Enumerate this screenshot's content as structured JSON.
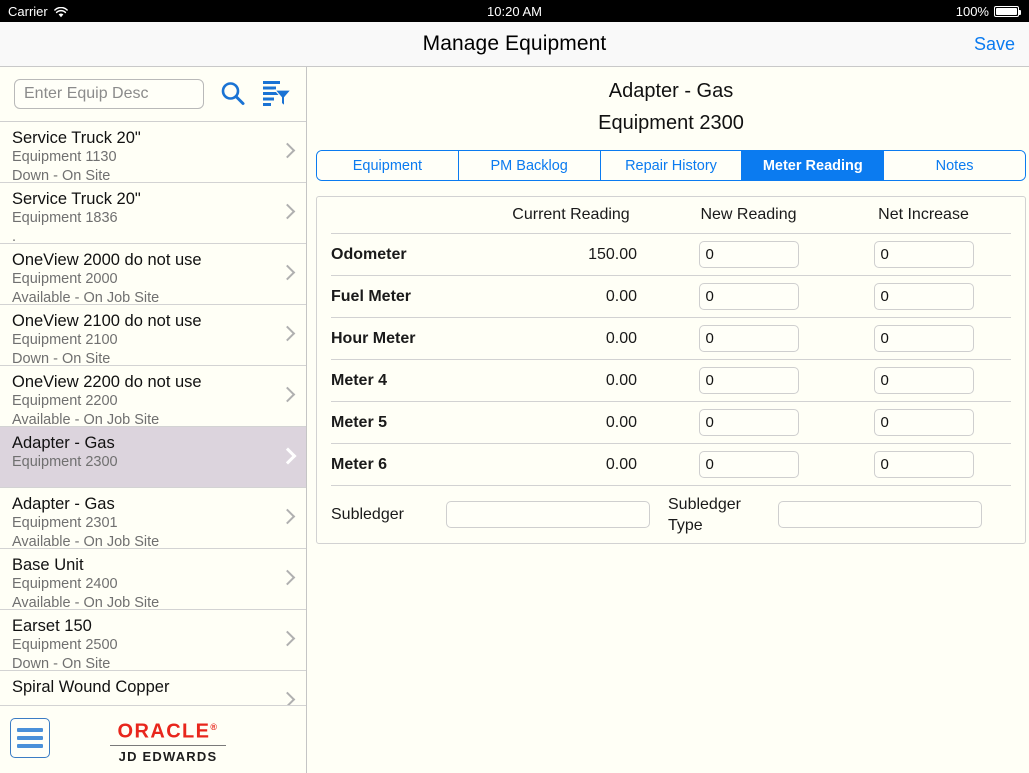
{
  "statusbar": {
    "carrier": "Carrier",
    "wifi_icon": "wifi-icon",
    "time": "10:20 AM",
    "battery_pct": "100%",
    "battery_icon": "battery-icon"
  },
  "navbar": {
    "title": "Manage Equipment",
    "save_label": "Save"
  },
  "sidebar": {
    "search": {
      "placeholder": "Enter Equip Desc",
      "value": "",
      "search_icon": "search-icon",
      "filter_icon": "filter-icon"
    },
    "items": [
      {
        "title": "Service Truck 20\"",
        "equipment": "Equipment 1130",
        "status": "Down - On Site",
        "selected": false
      },
      {
        "title": "Service Truck 20\"",
        "equipment": "Equipment 1836",
        "status": ".",
        "selected": false
      },
      {
        "title": "OneView 2000 do not use",
        "equipment": "Equipment 2000",
        "status": "Available - On Job Site",
        "selected": false
      },
      {
        "title": "OneView 2100 do not use",
        "equipment": "Equipment 2100",
        "status": "Down - On Site",
        "selected": false
      },
      {
        "title": "OneView 2200 do not use",
        "equipment": "Equipment 2200",
        "status": "Available - On Job Site",
        "selected": false
      },
      {
        "title": "Adapter - Gas",
        "equipment": "Equipment 2300",
        "status": "",
        "selected": true
      },
      {
        "title": "Adapter - Gas",
        "equipment": "Equipment 2301",
        "status": "Available - On Job Site",
        "selected": false
      },
      {
        "title": "Base Unit",
        "equipment": "Equipment 2400",
        "status": "Available - On Job Site",
        "selected": false
      },
      {
        "title": "Earset 150",
        "equipment": "Equipment 2500",
        "status": "Down - On Site",
        "selected": false
      },
      {
        "title": "Spiral Wound Copper",
        "equipment": "",
        "status": "",
        "selected": false
      }
    ],
    "footer": {
      "menu_icon": "hamburger-menu-icon",
      "brand": "ORACLE",
      "brand_mark": "®",
      "product": "JD EDWARDS"
    }
  },
  "detail": {
    "title": "Adapter - Gas",
    "subtitle": "Equipment 2300",
    "tabs": [
      {
        "label": "Equipment",
        "active": false
      },
      {
        "label": "PM Backlog",
        "active": false
      },
      {
        "label": "Repair History",
        "active": false
      },
      {
        "label": "Meter Reading",
        "active": true
      },
      {
        "label": "Notes",
        "active": false
      }
    ],
    "meter_table": {
      "headers": {
        "label": "",
        "current": "Current Reading",
        "new": "New Reading",
        "net": "Net Increase"
      },
      "rows": [
        {
          "label": "Odometer",
          "current": "150.00",
          "new": "0",
          "net": "0"
        },
        {
          "label": "Fuel Meter",
          "current": "0.00",
          "new": "0",
          "net": "0"
        },
        {
          "label": "Hour Meter",
          "current": "0.00",
          "new": "0",
          "net": "0"
        },
        {
          "label": "Meter 4",
          "current": "0.00",
          "new": "0",
          "net": "0"
        },
        {
          "label": "Meter 5",
          "current": "0.00",
          "new": "0",
          "net": "0"
        },
        {
          "label": "Meter 6",
          "current": "0.00",
          "new": "0",
          "net": "0"
        }
      ],
      "subledger": {
        "label": "Subledger",
        "value": "",
        "type_label": "Subledger Type",
        "type_value": ""
      }
    }
  },
  "colors": {
    "accent_blue": "#0b7bf0",
    "selected_row": "#dcd4dd",
    "oracle_red": "#e8261c",
    "page_bg": "#fffff6",
    "navbar_bg": "#f9f9f9"
  }
}
